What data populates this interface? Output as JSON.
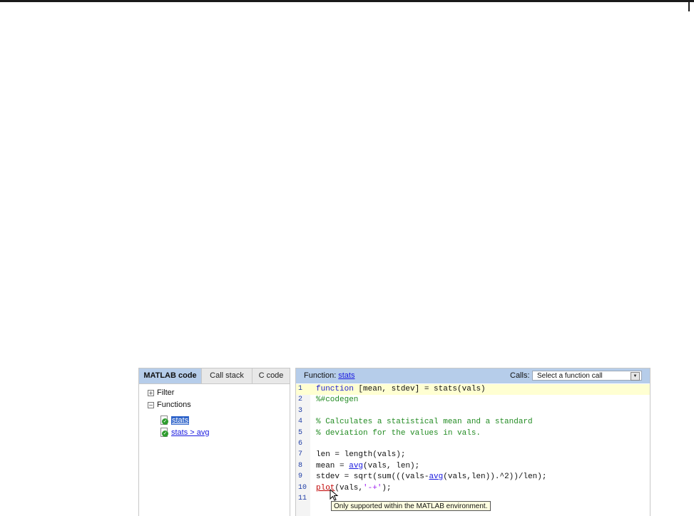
{
  "left_panel": {
    "tabs": [
      {
        "label": "MATLAB code",
        "active": true
      },
      {
        "label": "Call stack",
        "active": false
      },
      {
        "label": "C code",
        "active": false
      }
    ],
    "filter_label": "Filter",
    "filter_expander": "+",
    "functions_label": "Functions",
    "functions_expander": "−",
    "functions": [
      {
        "name": "stats",
        "status_icon": "check-icon",
        "selected": true
      },
      {
        "name": "stats > avg",
        "status_icon": "check-icon",
        "selected": false
      }
    ]
  },
  "right_panel": {
    "function_label": "Function:",
    "function_name": "stats",
    "calls_label": "Calls:",
    "calls_select": {
      "value": "Select a function call",
      "arrow": "▼"
    },
    "highlight_color": "#ffffd2",
    "lines": [
      {
        "n": "1",
        "parts": [
          {
            "t": "function",
            "c": "kw"
          },
          {
            "t": " [mean, stdev] = stats(vals)",
            "c": "plain"
          }
        ]
      },
      {
        "n": "2",
        "parts": [
          {
            "t": "%#codegen",
            "c": "cm"
          }
        ]
      },
      {
        "n": "3",
        "parts": []
      },
      {
        "n": "4",
        "parts": [
          {
            "t": "% Calculates a statistical mean and a standard",
            "c": "cm"
          }
        ]
      },
      {
        "n": "5",
        "parts": [
          {
            "t": "% deviation for the values in vals.",
            "c": "cm"
          }
        ]
      },
      {
        "n": "6",
        "parts": []
      },
      {
        "n": "7",
        "parts": [
          {
            "t": "len = length(vals);",
            "c": "plain"
          }
        ]
      },
      {
        "n": "8",
        "parts": [
          {
            "t": "mean = ",
            "c": "plain"
          },
          {
            "t": "avg",
            "c": "lk"
          },
          {
            "t": "(vals, len);",
            "c": "plain"
          }
        ]
      },
      {
        "n": "9",
        "parts": [
          {
            "t": "stdev = sqrt(sum(((vals-",
            "c": "plain"
          },
          {
            "t": "avg",
            "c": "lk"
          },
          {
            "t": "(vals,len)).^2))/len);",
            "c": "plain"
          }
        ]
      },
      {
        "n": "10",
        "parts": [
          {
            "t": "plot",
            "c": "warn"
          },
          {
            "t": "(vals,",
            "c": "plain"
          },
          {
            "t": "'-+'",
            "c": "str"
          },
          {
            "t": ");",
            "c": "plain"
          }
        ]
      },
      {
        "n": "11",
        "parts": []
      }
    ]
  },
  "tooltip": "Only supported within the MATLAB environment."
}
